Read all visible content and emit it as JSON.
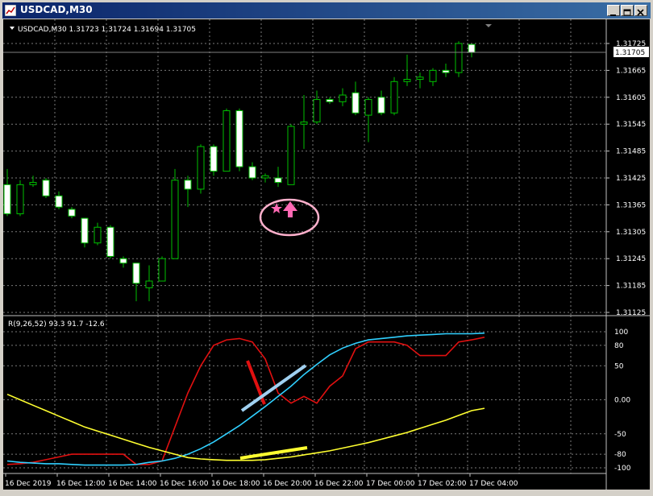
{
  "window": {
    "title": "USDCAD,M30"
  },
  "colors": {
    "background": "#000000",
    "grid": "#7a7a7a",
    "bull_candle": "#00c000",
    "bear_candle": "#ffffff",
    "red_line": "#e01010",
    "cyan_line": "#30d0ff",
    "yellow_line": "#ffff30",
    "annotation_pink": "#ffb0cc"
  },
  "chart": {
    "header": "USDCAD,M30  1.31723 1.31724 1.31694 1.31705",
    "price_labels": [
      "1.31725",
      "1.31665",
      "1.31605",
      "1.31545",
      "1.31485",
      "1.31425",
      "1.31365",
      "1.31305",
      "1.31245",
      "1.31185",
      "1.31125"
    ],
    "current_price": "1.31705",
    "time_labels": [
      "16 Dec 2019",
      "16 Dec 12:00",
      "16 Dec 14:00",
      "16 Dec 16:00",
      "16 Dec 18:00",
      "16 Dec 20:00",
      "16 Dec 22:00",
      "17 Dec 00:00",
      "17 Dec 02:00",
      "17 Dec 04:00"
    ],
    "annotation_icon": "star-arrow-up-icon"
  },
  "indicator": {
    "header": "R(9,26,52) 93.3 91.7 -12.6",
    "levels": [
      "100",
      "80",
      "50",
      "0.00",
      "-50",
      "-80",
      "-100"
    ]
  },
  "chart_data": {
    "type": "candlestick",
    "title": "USDCAD,M30",
    "ylim": [
      1.31115,
      1.31755
    ],
    "x": [
      "16 Dec 2019",
      "",
      "",
      "",
      "",
      "",
      "",
      "",
      "",
      "",
      "",
      "",
      "",
      "",
      "",
      "",
      "",
      "",
      "",
      "",
      "",
      "",
      "",
      "",
      "",
      "",
      "",
      "",
      "",
      "",
      "",
      "",
      "",
      "",
      "",
      ""
    ],
    "candles": [
      {
        "o": 1.3141,
        "h": 1.31445,
        "l": 1.3134,
        "c": 1.31345
      },
      {
        "o": 1.31345,
        "h": 1.3142,
        "l": 1.3134,
        "c": 1.3141
      },
      {
        "o": 1.3141,
        "h": 1.3143,
        "l": 1.31405,
        "c": 1.31415
      },
      {
        "o": 1.3142,
        "h": 1.31425,
        "l": 1.3138,
        "c": 1.31385
      },
      {
        "o": 1.31385,
        "h": 1.31395,
        "l": 1.31355,
        "c": 1.3136
      },
      {
        "o": 1.31355,
        "h": 1.3136,
        "l": 1.31335,
        "c": 1.3134
      },
      {
        "o": 1.31335,
        "h": 1.31335,
        "l": 1.3127,
        "c": 1.3128
      },
      {
        "o": 1.3128,
        "h": 1.31325,
        "l": 1.31275,
        "c": 1.31315
      },
      {
        "o": 1.31315,
        "h": 1.3132,
        "l": 1.31245,
        "c": 1.3125
      },
      {
        "o": 1.31245,
        "h": 1.3125,
        "l": 1.31225,
        "c": 1.31235
      },
      {
        "o": 1.31235,
        "h": 1.31235,
        "l": 1.3115,
        "c": 1.3119
      },
      {
        "o": 1.3118,
        "h": 1.3123,
        "l": 1.3115,
        "c": 1.31195
      },
      {
        "o": 1.31195,
        "h": 1.3125,
        "l": 1.31195,
        "c": 1.31245
      },
      {
        "o": 1.31245,
        "h": 1.31445,
        "l": 1.31245,
        "c": 1.3142
      },
      {
        "o": 1.3142,
        "h": 1.3143,
        "l": 1.3136,
        "c": 1.314
      },
      {
        "o": 1.314,
        "h": 1.315,
        "l": 1.3139,
        "c": 1.31495
      },
      {
        "o": 1.31495,
        "h": 1.315,
        "l": 1.3143,
        "c": 1.3144
      },
      {
        "o": 1.3144,
        "h": 1.3158,
        "l": 1.3144,
        "c": 1.31575
      },
      {
        "o": 1.31575,
        "h": 1.3158,
        "l": 1.3144,
        "c": 1.3145
      },
      {
        "o": 1.3145,
        "h": 1.3146,
        "l": 1.3142,
        "c": 1.31425
      },
      {
        "o": 1.31425,
        "h": 1.31435,
        "l": 1.31415,
        "c": 1.3143
      },
      {
        "o": 1.31425,
        "h": 1.3145,
        "l": 1.31405,
        "c": 1.31415
      },
      {
        "o": 1.3141,
        "h": 1.31545,
        "l": 1.3141,
        "c": 1.3154
      },
      {
        "o": 1.31545,
        "h": 1.3161,
        "l": 1.3149,
        "c": 1.3155
      },
      {
        "o": 1.3155,
        "h": 1.3162,
        "l": 1.31545,
        "c": 1.316
      },
      {
        "o": 1.316,
        "h": 1.31605,
        "l": 1.3159,
        "c": 1.31595
      },
      {
        "o": 1.31595,
        "h": 1.31625,
        "l": 1.31585,
        "c": 1.3161
      },
      {
        "o": 1.31615,
        "h": 1.3164,
        "l": 1.31565,
        "c": 1.3157
      },
      {
        "o": 1.31565,
        "h": 1.31605,
        "l": 1.31505,
        "c": 1.316
      },
      {
        "o": 1.31605,
        "h": 1.3162,
        "l": 1.31565,
        "c": 1.3157
      },
      {
        "o": 1.3157,
        "h": 1.3165,
        "l": 1.31565,
        "c": 1.3164
      },
      {
        "o": 1.3164,
        "h": 1.317,
        "l": 1.3163,
        "c": 1.31645
      },
      {
        "o": 1.31645,
        "h": 1.3166,
        "l": 1.31625,
        "c": 1.3165
      },
      {
        "o": 1.3164,
        "h": 1.3167,
        "l": 1.3163,
        "c": 1.31665
      },
      {
        "o": 1.31665,
        "h": 1.3168,
        "l": 1.3165,
        "c": 1.3166
      },
      {
        "o": 1.3166,
        "h": 1.3173,
        "l": 1.3165,
        "c": 1.31725
      },
      {
        "o": 1.31723,
        "h": 1.31724,
        "l": 1.31694,
        "c": 1.31705
      }
    ],
    "indicator": {
      "name": "R(9,26,52)",
      "ylim": [
        -105,
        110
      ],
      "levels": [
        100,
        80,
        50,
        0,
        -50,
        -80,
        -100
      ],
      "series": [
        {
          "values": [
            -95,
            -94,
            -92,
            -88,
            -84,
            -80,
            -80,
            -80,
            -80,
            -80,
            -95,
            -95,
            -90,
            -40,
            10,
            50,
            80,
            88,
            90,
            85,
            60,
            10,
            -5,
            5,
            -5,
            20,
            35,
            75,
            85,
            85,
            85,
            80,
            65,
            65,
            65,
            85,
            88,
            92
          ]
        },
        {
          "values": [
            -90,
            -92,
            -93,
            -94,
            -94,
            -95,
            -96,
            -96,
            -96,
            -96,
            -95,
            -92,
            -90,
            -86,
            -80,
            -72,
            -62,
            -50,
            -38,
            -24,
            -10,
            5,
            20,
            37,
            52,
            66,
            76,
            83,
            88,
            90,
            92,
            94,
            95,
            96,
            97,
            97,
            97,
            98
          ]
        },
        {
          "values": [
            8,
            0,
            -8,
            -16,
            -24,
            -32,
            -40,
            -46,
            -52,
            -58,
            -64,
            -70,
            -75,
            -80,
            -85,
            -87,
            -88,
            -89,
            -89,
            -89,
            -88,
            -86,
            -84,
            -81,
            -78,
            -75,
            -71,
            -67,
            -63,
            -58,
            -53,
            -48,
            -42,
            -36,
            -30,
            -23,
            -16,
            -12.6
          ]
        }
      ]
    }
  }
}
